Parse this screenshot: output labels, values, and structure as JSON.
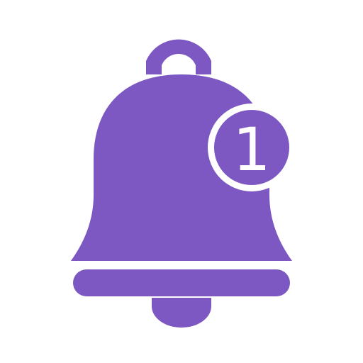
{
  "icon": {
    "name": "notification-bell-icon",
    "badge": {
      "count": "1"
    }
  },
  "colors": {
    "primary": "#7d58c2",
    "background": "#ffffff"
  }
}
